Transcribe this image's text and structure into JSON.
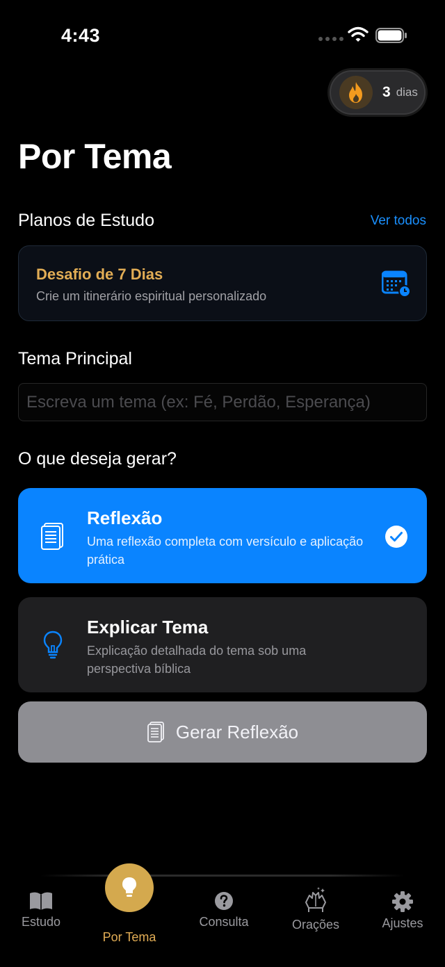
{
  "status_bar": {
    "time": "4:43"
  },
  "streak": {
    "count": "3",
    "unit": "dias"
  },
  "page_title": "Por Tema",
  "study_plans": {
    "heading": "Planos de Estudo",
    "see_all": "Ver todos",
    "card": {
      "title": "Desafio de 7 Dias",
      "subtitle": "Crie um itinerário espiritual personalizado"
    }
  },
  "main_theme": {
    "heading": "Tema Principal",
    "placeholder": "Escreva um tema (ex: Fé, Perdão, Esperança)",
    "value": ""
  },
  "generate_options": {
    "heading": "O que deseja gerar?",
    "options": [
      {
        "title": "Reflexão",
        "description": "Uma reflexão completa com versículo e aplicação prática",
        "selected": true
      },
      {
        "title": "Explicar Tema",
        "description": "Explicação detalhada do tema sob uma perspectiva bíblica",
        "selected": false
      }
    ]
  },
  "generate_button": {
    "label": "Gerar Reflexão"
  },
  "tab_bar": {
    "tabs": [
      {
        "label": "Estudo",
        "icon": "book-icon"
      },
      {
        "label": "Por Tema",
        "icon": "lightbulb-icon",
        "active": true
      },
      {
        "label": "Consulta",
        "icon": "question-circle-icon"
      },
      {
        "label": "Orações",
        "icon": "praying-hands-icon"
      },
      {
        "label": "Ajustes",
        "icon": "gear-icon"
      }
    ]
  },
  "colors": {
    "accent_blue": "#0a84ff",
    "accent_gold": "#e2ad55",
    "background": "#000000",
    "card_dark": "#1f1f21",
    "button_disabled": "#8e8e93"
  }
}
